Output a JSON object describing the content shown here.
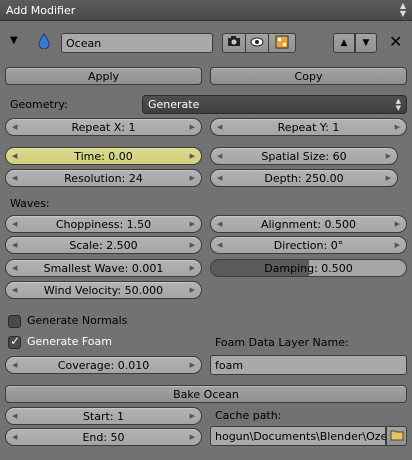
{
  "header": {
    "add_modifier": "Add Modifier"
  },
  "modifier": {
    "name": "Ocean",
    "apply_label": "Apply",
    "copy_label": "Copy"
  },
  "geometry": {
    "label": "Geometry:",
    "value": "Generate",
    "repeat_x": "Repeat X: 1",
    "repeat_y": "Repeat Y: 1"
  },
  "params": {
    "time": "Time: 0.00",
    "spatial_size": "Spatial Size: 60",
    "resolution": "Resolution: 24",
    "depth": "Depth: 250.00"
  },
  "waves": {
    "label": "Waves:",
    "choppiness": "Choppiness: 1.50",
    "alignment": "Alignment: 0.500",
    "scale": "Scale: 2.500",
    "direction": "Direction: 0°",
    "smallest_wave": "Smallest Wave: 0.001",
    "damping": "Damping: 0.500",
    "damping_value": 0.5,
    "wind_velocity": "Wind Velocity: 50.000"
  },
  "normals": {
    "label": "Generate Normals",
    "checked": false
  },
  "foam": {
    "label": "Generate Foam",
    "checked": true,
    "layer_name_label": "Foam Data Layer Name:",
    "layer_name_value": "foam",
    "coverage": "Coverage: 0.010"
  },
  "bake": {
    "label": "Bake Ocean",
    "start": "Start: 1",
    "end": "End: 50",
    "cache_path_label": "Cache path:",
    "cache_path_value": "hogun\\Documents\\Blender\\Ozean\\"
  },
  "colors": {
    "panel": "#727272",
    "highlight": "#d4d487",
    "field": "#acacac"
  }
}
